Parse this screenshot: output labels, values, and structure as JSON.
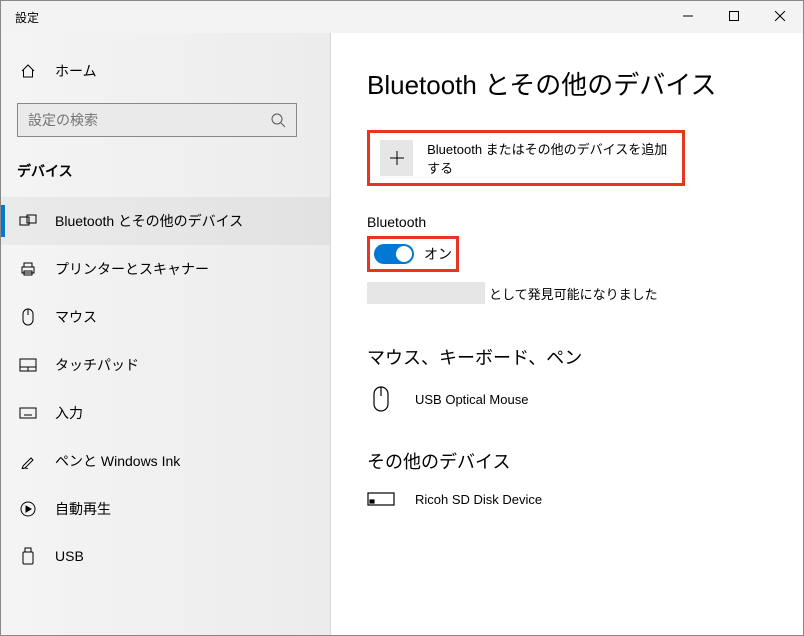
{
  "window": {
    "title": "設定"
  },
  "sidebar": {
    "home_label": "ホーム",
    "search_placeholder": "設定の検索",
    "section_label": "デバイス",
    "items": [
      {
        "label": "Bluetooth とその他のデバイス",
        "active": true
      },
      {
        "label": "プリンターとスキャナー"
      },
      {
        "label": "マウス"
      },
      {
        "label": "タッチパッド"
      },
      {
        "label": "入力"
      },
      {
        "label": "ペンと Windows Ink"
      },
      {
        "label": "自動再生"
      },
      {
        "label": "USB"
      }
    ]
  },
  "main": {
    "title": "Bluetooth とその他のデバイス",
    "add_device_label": "Bluetooth またはその他のデバイスを追加する",
    "bluetooth": {
      "header": "Bluetooth",
      "toggle_state": "on",
      "toggle_label": "オン",
      "discoverable_suffix": "として発見可能になりました"
    },
    "groups": [
      {
        "title": "マウス、キーボード、ペン",
        "device_name": "USB Optical Mouse"
      },
      {
        "title": "その他のデバイス",
        "device_name": "Ricoh SD Disk Device"
      }
    ]
  }
}
